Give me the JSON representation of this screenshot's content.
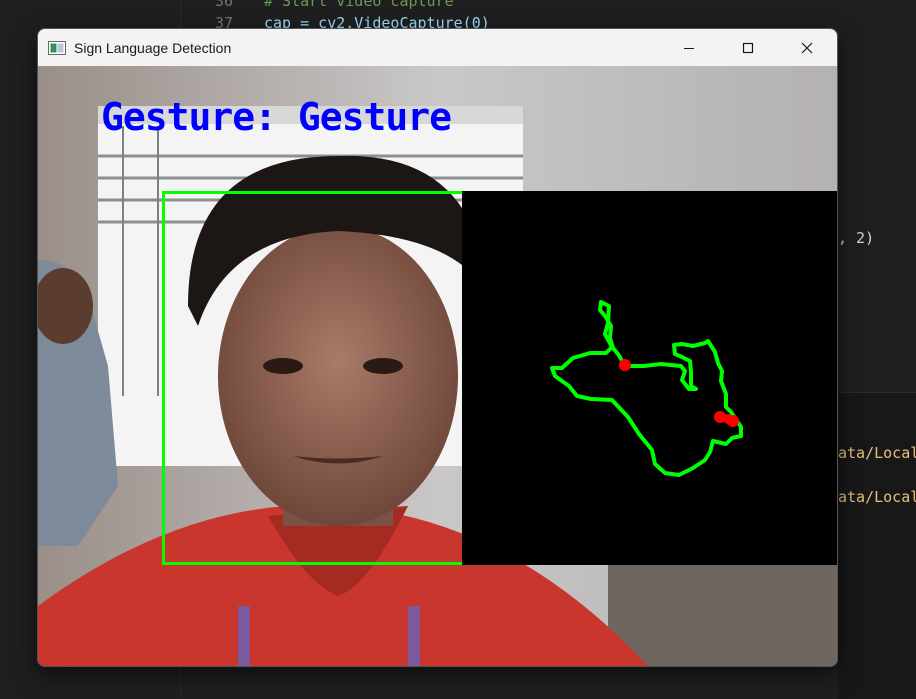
{
  "editor": {
    "lines": [
      {
        "number": "36",
        "text": "# Start video capture",
        "color": "#6a9955"
      },
      {
        "number": "37",
        "text": "cap = cv2.VideoCapture(0)",
        "color": "#9cdcfe"
      }
    ],
    "fragment_args": ", 2)",
    "fragment_path_1": "ata/Local",
    "fragment_path_2": "ata/Local"
  },
  "window": {
    "title": "Sign Language Detection",
    "controls": {
      "minimize": "minimize",
      "maximize": "maximize",
      "close": "close"
    }
  },
  "overlay": {
    "gesture_text": "Gesture: Gesture",
    "colors": {
      "text": "#0000ff",
      "roi": "#00ff00",
      "contour": "#00ff00",
      "defect": "#ff0000"
    }
  }
}
